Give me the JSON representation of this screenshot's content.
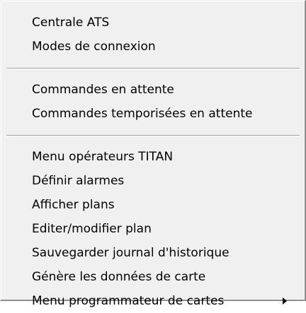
{
  "menu": {
    "groups": [
      {
        "items": [
          {
            "label": "Centrale ATS"
          },
          {
            "label": "Modes de connexion"
          }
        ]
      },
      {
        "items": [
          {
            "label": "Commandes en attente"
          },
          {
            "label": "Commandes temporisées en attente"
          }
        ]
      },
      {
        "items": [
          {
            "label": "Menu opérateurs TITAN"
          },
          {
            "label": "Définir alarmes"
          },
          {
            "label": "Afficher plans"
          },
          {
            "label": "Editer/modifier plan"
          },
          {
            "label": "Sauvegarder journal d'historique"
          },
          {
            "label": "Génère les données de carte"
          },
          {
            "label": "Menu programmateur de cartes",
            "submenu_icon": "triangle-right-icon"
          }
        ]
      }
    ]
  }
}
